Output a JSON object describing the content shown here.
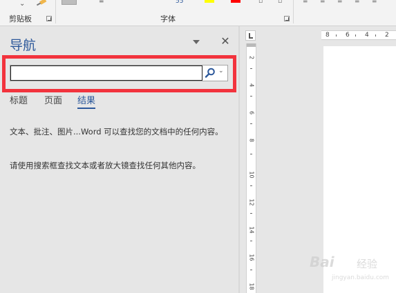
{
  "ribbon": {
    "clipboard_label": "剪贴板",
    "font_label": "字体",
    "paste_chevron": "⌄",
    "glyph1": "≡",
    "glyph2": "55",
    "colors": {
      "highlight": "#ffff00",
      "font_color": "#ff0000",
      "accent": "#2b579a"
    }
  },
  "nav": {
    "title": "导航",
    "search": {
      "value": "",
      "placeholder": "",
      "dropdown_glyph": "⌄"
    },
    "close_glyph": "✕",
    "tabs": [
      {
        "label": "标题",
        "active": false
      },
      {
        "label": "页面",
        "active": false
      },
      {
        "label": "结果",
        "active": true
      }
    ],
    "message1": "文本、批注、图片...Word 可以查找您的文档中的任何内容。",
    "message2": "请使用搜索框查找文本或者放大镜查找任何其他内容。"
  },
  "rulers": {
    "vertical": [
      "2",
      "4",
      "6",
      "8",
      "10",
      "12",
      "14",
      "16",
      "18"
    ],
    "horizontal": [
      "8",
      "6",
      "4",
      "2"
    ]
  },
  "watermark": {
    "text": "Bai",
    "cn": "经验",
    "url": "jingyan.baidu.com"
  }
}
